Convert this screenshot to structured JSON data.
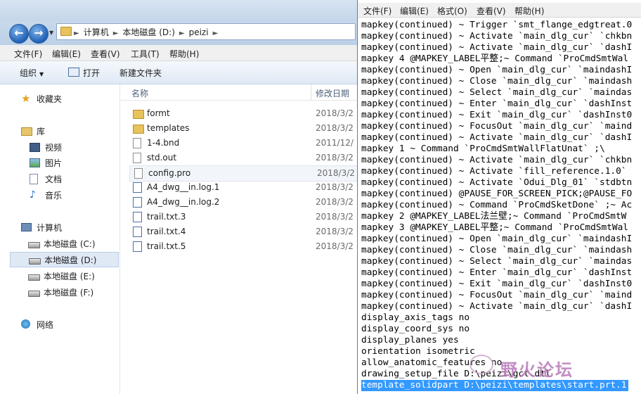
{
  "explorer": {
    "address": [
      "计算机",
      "本地磁盘 (D:)",
      "peizi"
    ],
    "menu": [
      "文件(F)",
      "编辑(E)",
      "查看(V)",
      "工具(T)",
      "帮助(H)"
    ],
    "toolbar": {
      "organize": "组织",
      "open": "打开",
      "new_folder": "新建文件夹"
    },
    "sidebar": {
      "favorites": "收藏夹",
      "libraries": "库",
      "video": "视频",
      "pictures": "图片",
      "documents": "文档",
      "music": "音乐",
      "computer": "计算机",
      "drive_c": "本地磁盘 (C:)",
      "drive_d": "本地磁盘 (D:)",
      "drive_e": "本地磁盘 (E:)",
      "drive_f": "本地磁盘 (F:)",
      "network": "网络"
    },
    "columns": {
      "name": "名称",
      "date": "修改日期"
    },
    "files": [
      {
        "name": "formt",
        "date": "2018/3/2",
        "icon": "folder-icon"
      },
      {
        "name": "templates",
        "date": "2018/3/2",
        "icon": "folder-icon"
      },
      {
        "name": "1-4.bnd",
        "date": "2011/12/",
        "icon": "file-icon"
      },
      {
        "name": "std.out",
        "date": "2018/3/2",
        "icon": "file-icon"
      },
      {
        "name": "config.pro",
        "date": "2018/3/2",
        "icon": "file-icon"
      },
      {
        "name": "A4_dwg__in.log.1",
        "date": "2018/3/2",
        "icon": "log-file-icon"
      },
      {
        "name": "A4_dwg__in.log.2",
        "date": "2018/3/2",
        "icon": "log-file-icon"
      },
      {
        "name": "trail.txt.3",
        "date": "2018/3/2",
        "icon": "log-file-icon"
      },
      {
        "name": "trail.txt.4",
        "date": "2018/3/2",
        "icon": "log-file-icon"
      },
      {
        "name": "trail.txt.5",
        "date": "2018/3/2",
        "icon": "log-file-icon"
      }
    ]
  },
  "notepad": {
    "menu": [
      "文件(F)",
      "编辑(E)",
      "格式(O)",
      "查看(V)",
      "帮助(H)"
    ],
    "lines": [
      "mapkey(continued) ~ Trigger `smt_flange_edgtreat.0",
      "mapkey(continued) ~ Activate `main_dlg_cur` `chkbn",
      "mapkey(continued) ~ Activate `main_dlg_cur` `dashI",
      "mapkey 4 @MAPKEY_LABEL平整;~ Command `ProCmdSmtWal",
      "mapkey(continued) ~ Open `main_dlg_cur` `maindashI",
      "mapkey(continued) ~ Close `main_dlg_cur` `maindash",
      "mapkey(continued) ~ Select `main_dlg_cur` `maindas",
      "mapkey(continued) ~ Enter `main_dlg_cur` `dashInst",
      "mapkey(continued) ~ Exit `main_dlg_cur` `dashInst0",
      "mapkey(continued) ~ FocusOut `main_dlg_cur` `maind",
      "mapkey(continued) ~ Activate `main_dlg_cur` `dashI",
      "mapkey 1 ~ Command `ProCmdSmtWallFlatUnat` ;\\",
      "mapkey(continued) ~ Activate `main_dlg_cur` `chkbn",
      "mapkey(continued) ~ Activate `fill_reference.1.0`",
      "mapkey(continued) ~ Activate `Odui_Dlg_01` `stdbtn",
      "mapkey(continued) @PAUSE_FOR_SCREEN_PICK;@PAUSE_FO",
      "mapkey(continued) ~ Command `ProCmdSketDone` ;~ Ac",
      "mapkey 2 @MAPKEY_LABEL法兰壁;~ Command `ProCmdSmtW",
      "mapkey 3 @MAPKEY_LABEL平整;~ Command `ProCmdSmtWal",
      "mapkey(continued) ~ Open `main_dlg_cur` `maindashI",
      "mapkey(continued) ~ Close `main_dlg_cur` `maindash",
      "mapkey(continued) ~ Select `main_dlg_cur` `maindas",
      "mapkey(continued) ~ Enter `main_dlg_cur` `dashInst",
      "mapkey(continued) ~ Exit `main_dlg_cur` `dashInst0",
      "mapkey(continued) ~ FocusOut `main_dlg_cur` `maind",
      "mapkey(continued) ~ Activate `main_dlg_cur` `dashI",
      "display_axis_tags no",
      "display_coord_sys no",
      "display_planes yes",
      "orientation isometric",
      "allow_anatomic_features no",
      "drawing_setup_file D:\\peizi\\gct.dtl",
      "template_solidpart D:\\peizi\\templates\\start.prt.1"
    ],
    "selected_line_index": 32
  },
  "watermark": {
    "text": "野火论坛"
  },
  "colors": {
    "selection": "#3399ff",
    "folder": "#e8c25b",
    "accent": "#1f5fb5"
  }
}
